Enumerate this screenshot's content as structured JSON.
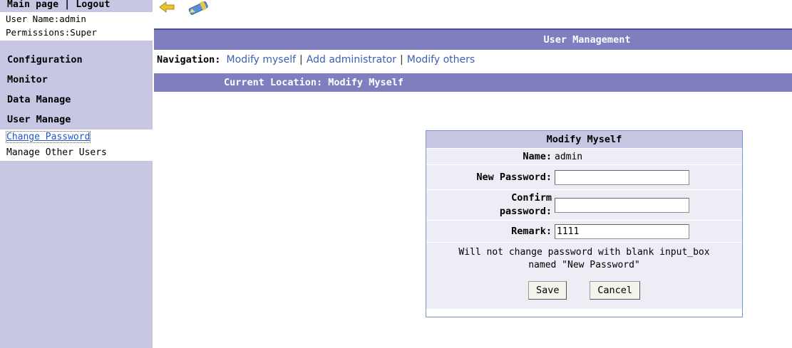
{
  "sidebar": {
    "main_page": "Main page",
    "divider": "|",
    "logout": "Logout",
    "user_name": "User Name:admin",
    "permissions": "Permissions:Super",
    "menu": [
      {
        "label": "Configuration"
      },
      {
        "label": "Monitor"
      },
      {
        "label": "Data Manage"
      },
      {
        "label": "User Manage"
      }
    ],
    "submenu": [
      {
        "label": "Change Password"
      },
      {
        "label": "Manage Other Users"
      }
    ]
  },
  "toolbar": {
    "back_icon": "back-arrow-icon",
    "edit_icon": "pencil-edit-icon",
    "back_color": "#e8c23a",
    "edit_color": "#5a8fd6"
  },
  "main": {
    "title": "User Management",
    "nav_label": "Navigation:",
    "nav_links": [
      "Modify myself",
      "Add administrator",
      "Modify others"
    ],
    "nav_sep": "|",
    "location": "Current Location: Modify Myself"
  },
  "form": {
    "title": "Modify Myself",
    "name_label": "Name:",
    "name_value": "admin",
    "new_password_label": "New Password:",
    "new_password_value": "",
    "confirm_label_1": "Confirm",
    "confirm_label_2": "password:",
    "confirm_value": "",
    "remark_label": "Remark:",
    "remark_value": "1111",
    "note_line1": "Will not change password with blank input_box",
    "note_line2": "named \"New Password\"",
    "save_label": "Save",
    "cancel_label": "Cancel"
  },
  "colors": {
    "sidebar_bg": "#c7c7e3",
    "header_bg": "#7f7fc0",
    "link": "#3b5fb4",
    "row_bg": "#ededf6"
  }
}
